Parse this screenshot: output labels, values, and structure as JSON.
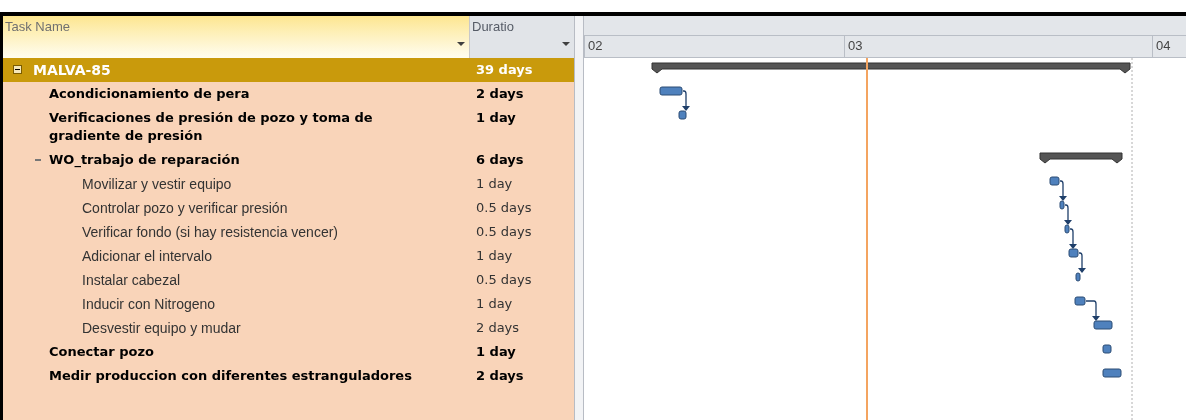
{
  "table": {
    "columns": [
      {
        "label": "Task Name"
      },
      {
        "label": "Duratio"
      }
    ]
  },
  "tasks": [
    {
      "name": "MALVA-85",
      "duration": "39 days",
      "expanded": true,
      "children": [
        {
          "name": "Acondicionamiento de pera",
          "duration": "2 days"
        },
        {
          "name": "Verificaciones de presión de pozo y toma de gradiente de presión",
          "duration": "1 day"
        },
        {
          "name": "WO_trabajo de reparación",
          "duration": "6 days",
          "expanded": true,
          "children": [
            {
              "name": "Movilizar y vestir equipo",
              "duration": "1 day"
            },
            {
              "name": "Controlar pozo y verificar presión",
              "duration": "0.5 days"
            },
            {
              "name": "Verificar fondo (si hay resistencia vencer)",
              "duration": "0.5 days"
            },
            {
              "name": "Adicionar el intervalo",
              "duration": "1 day"
            },
            {
              "name": "Instalar cabezal",
              "duration": "0.5 days"
            },
            {
              "name": "Inducir con Nitrogeno",
              "duration": "1 day"
            },
            {
              "name": "Desvestir equipo y mudar",
              "duration": "2 days"
            }
          ]
        },
        {
          "name": "Conectar pozo",
          "duration": "1 day"
        },
        {
          "name": "Medir produccion con diferentes estranguladores",
          "duration": "2 days"
        }
      ]
    }
  ],
  "timescale": [
    "02",
    "03",
    "04"
  ]
}
